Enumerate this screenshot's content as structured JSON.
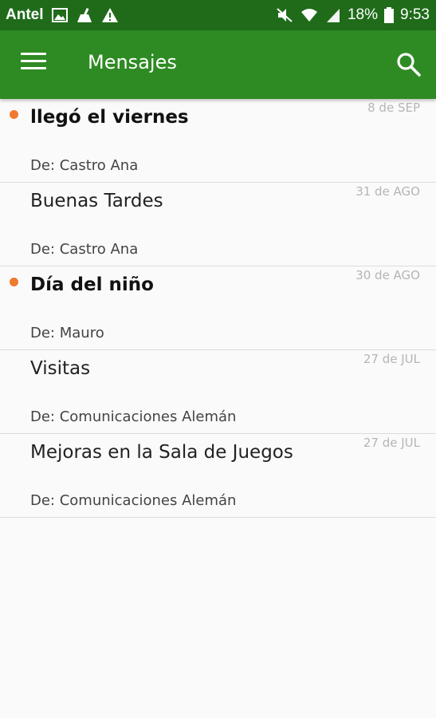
{
  "status_bar": {
    "carrier": "Antel",
    "battery": "18%",
    "time": "9:53"
  },
  "app_bar": {
    "title": "Mensajes"
  },
  "messages": [
    {
      "subject": "llegó el viernes",
      "sender": "De: Castro Ana",
      "date": "8 de SEP",
      "unread": true
    },
    {
      "subject": "Buenas Tardes",
      "sender": "De: Castro Ana",
      "date": "31 de AGO",
      "unread": false
    },
    {
      "subject": "Día del niño",
      "sender": "De: Mauro",
      "date": "30 de AGO",
      "unread": true
    },
    {
      "subject": "Visitas",
      "sender": "De: Comunicaciones Alemán",
      "date": "27 de JUL",
      "unread": false
    },
    {
      "subject": "Mejoras en la Sala de Juegos",
      "sender": "De: Comunicaciones Alemán",
      "date": "27 de JUL",
      "unread": false
    }
  ],
  "colors": {
    "app_bar": "#2e8b23",
    "status_bar": "#1f6b1a",
    "unread_dot": "#f07a2e"
  },
  "icons": [
    "image-icon",
    "cleaner-icon",
    "warning-icon",
    "mute-icon",
    "wifi-icon",
    "signal-icon",
    "battery-icon",
    "menu-icon",
    "search-icon"
  ]
}
